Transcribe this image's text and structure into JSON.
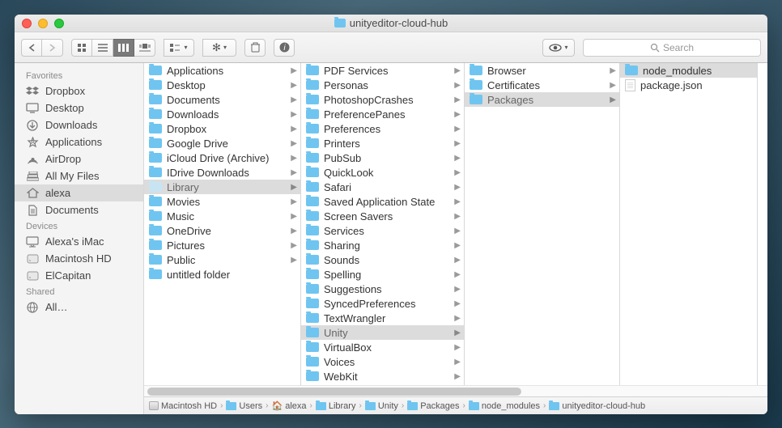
{
  "title": "unityeditor-cloud-hub",
  "search_placeholder": "Search",
  "sidebar": {
    "groups": [
      {
        "label": "Favorites",
        "items": [
          {
            "icon": "dropbox",
            "label": "Dropbox"
          },
          {
            "icon": "desktop",
            "label": "Desktop"
          },
          {
            "icon": "downloads",
            "label": "Downloads"
          },
          {
            "icon": "applications",
            "label": "Applications"
          },
          {
            "icon": "airdrop",
            "label": "AirDrop"
          },
          {
            "icon": "allfiles",
            "label": "All My Files"
          },
          {
            "icon": "home",
            "label": "alexa",
            "selected": true
          },
          {
            "icon": "documents",
            "label": "Documents"
          }
        ]
      },
      {
        "label": "Devices",
        "items": [
          {
            "icon": "imac",
            "label": "Alexa's iMac"
          },
          {
            "icon": "hd",
            "label": "Macintosh HD"
          },
          {
            "icon": "hd",
            "label": "ElCapitan"
          }
        ]
      },
      {
        "label": "Shared",
        "items": [
          {
            "icon": "globe",
            "label": "All…"
          }
        ]
      }
    ]
  },
  "columns": [
    {
      "items": [
        {
          "name": "Applications",
          "type": "folder",
          "arrow": true
        },
        {
          "name": "Desktop",
          "type": "folder",
          "arrow": true
        },
        {
          "name": "Documents",
          "type": "folder",
          "arrow": true
        },
        {
          "name": "Downloads",
          "type": "folder",
          "arrow": true
        },
        {
          "name": "Dropbox",
          "type": "folder",
          "arrow": true
        },
        {
          "name": "Google Drive",
          "type": "folder",
          "arrow": true
        },
        {
          "name": "iCloud Drive (Archive)",
          "type": "folder",
          "arrow": true
        },
        {
          "name": "IDrive Downloads",
          "type": "folder",
          "arrow": true
        },
        {
          "name": "Library",
          "type": "folder",
          "arrow": true,
          "selected": true,
          "dim": true
        },
        {
          "name": "Movies",
          "type": "folder",
          "arrow": true
        },
        {
          "name": "Music",
          "type": "folder",
          "arrow": true
        },
        {
          "name": "OneDrive",
          "type": "folder",
          "arrow": true
        },
        {
          "name": "Pictures",
          "type": "folder",
          "arrow": true
        },
        {
          "name": "Public",
          "type": "folder",
          "arrow": true
        },
        {
          "name": "untitled folder",
          "type": "folder",
          "arrow": false
        }
      ]
    },
    {
      "items": [
        {
          "name": "PDF Services",
          "type": "folder",
          "arrow": true
        },
        {
          "name": "Personas",
          "type": "folder",
          "arrow": true
        },
        {
          "name": "PhotoshopCrashes",
          "type": "folder",
          "arrow": true
        },
        {
          "name": "PreferencePanes",
          "type": "folder",
          "arrow": true
        },
        {
          "name": "Preferences",
          "type": "folder",
          "arrow": true
        },
        {
          "name": "Printers",
          "type": "folder",
          "arrow": true
        },
        {
          "name": "PubSub",
          "type": "folder",
          "arrow": true
        },
        {
          "name": "QuickLook",
          "type": "folder",
          "arrow": true
        },
        {
          "name": "Safari",
          "type": "folder",
          "arrow": true
        },
        {
          "name": "Saved Application State",
          "type": "folder",
          "arrow": true
        },
        {
          "name": "Screen Savers",
          "type": "folder",
          "arrow": true
        },
        {
          "name": "Services",
          "type": "folder",
          "arrow": true
        },
        {
          "name": "Sharing",
          "type": "folder",
          "arrow": true
        },
        {
          "name": "Sounds",
          "type": "folder",
          "arrow": true
        },
        {
          "name": "Spelling",
          "type": "folder",
          "arrow": true
        },
        {
          "name": "Suggestions",
          "type": "folder",
          "arrow": true
        },
        {
          "name": "SyncedPreferences",
          "type": "folder",
          "arrow": true
        },
        {
          "name": "TextWrangler",
          "type": "folder",
          "arrow": true
        },
        {
          "name": "Unity",
          "type": "folder",
          "arrow": true,
          "selected": true
        },
        {
          "name": "VirtualBox",
          "type": "folder",
          "arrow": true
        },
        {
          "name": "Voices",
          "type": "folder",
          "arrow": true
        },
        {
          "name": "WebKit",
          "type": "folder",
          "arrow": true
        }
      ]
    },
    {
      "items": [
        {
          "name": "Browser",
          "type": "folder",
          "arrow": true
        },
        {
          "name": "Certificates",
          "type": "folder",
          "arrow": true
        },
        {
          "name": "Packages",
          "type": "folder",
          "arrow": true,
          "selected": true
        }
      ]
    },
    {
      "items": [
        {
          "name": "node_modules",
          "type": "folder",
          "arrow": false,
          "selected": true
        },
        {
          "name": "package.json",
          "type": "file",
          "arrow": false
        }
      ]
    }
  ],
  "pathbar": [
    {
      "icon": "hd",
      "label": "Macintosh HD"
    },
    {
      "icon": "folder",
      "label": "Users"
    },
    {
      "icon": "home",
      "label": "alexa"
    },
    {
      "icon": "folder",
      "label": "Library"
    },
    {
      "icon": "folder",
      "label": "Unity"
    },
    {
      "icon": "folder",
      "label": "Packages"
    },
    {
      "icon": "folder",
      "label": "node_modules"
    },
    {
      "icon": "folder",
      "label": "unityeditor-cloud-hub"
    }
  ]
}
